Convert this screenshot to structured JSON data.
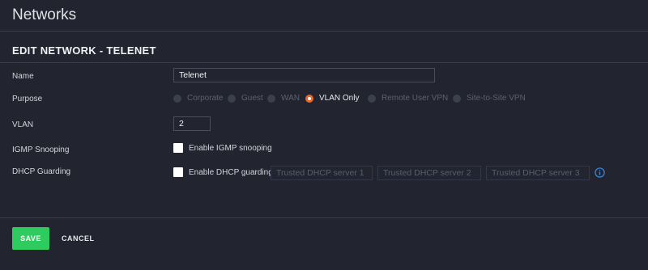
{
  "page": {
    "title": "Networks"
  },
  "form": {
    "title": "EDIT NETWORK - TELENET",
    "name": {
      "label": "Name",
      "value": "Telenet"
    },
    "purpose": {
      "label": "Purpose",
      "options": [
        "Corporate",
        "Guest",
        "WAN",
        "VLAN Only",
        "Remote User VPN",
        "Site-to-Site VPN"
      ],
      "selected": "VLAN Only"
    },
    "vlan": {
      "label": "VLAN",
      "value": "2"
    },
    "igmp": {
      "label": "IGMP Snooping",
      "checkbox_label": "Enable IGMP snooping",
      "checked": false
    },
    "dhcp_guarding": {
      "label": "DHCP Guarding",
      "checkbox_label": "Enable DHCP guarding",
      "checked": false,
      "server1_placeholder": "Trusted DHCP server 1",
      "server2_placeholder": "Trusted DHCP server 2",
      "server3_placeholder": "Trusted DHCP server 3",
      "info_icon": "info-circle-icon"
    }
  },
  "actions": {
    "save_label": "SAVE",
    "cancel_label": "CANCEL"
  },
  "colors": {
    "background": "#22242f",
    "save_button": "#2ecc5e",
    "radio_selected": "#e5682d",
    "info_icon": "#3a8be0"
  }
}
